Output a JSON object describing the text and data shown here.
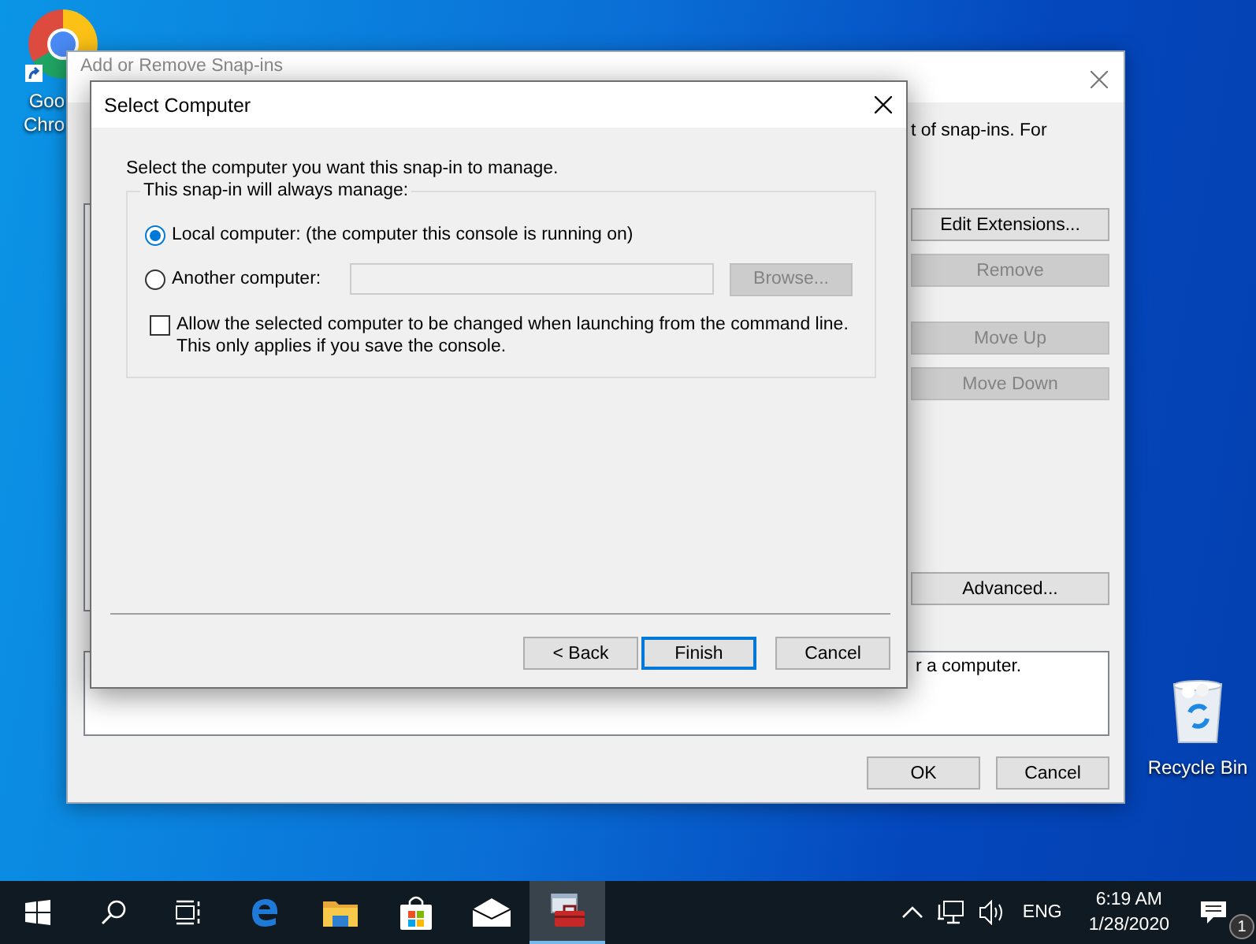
{
  "desktop_icons": [
    {
      "kind": "chrome",
      "label_lines": [
        "Goo",
        "Chro"
      ]
    },
    {
      "kind": "recycle-bin",
      "label_lines": [
        "Recycle Bin"
      ]
    }
  ],
  "back_window": {
    "title": "Add or Remove Snap-ins",
    "intro_right": "t of snap-ins. For",
    "description_text": "r a computer.",
    "side_buttons": [
      {
        "label": "Edit Extensions...",
        "disabled": false
      },
      {
        "label": "Remove",
        "disabled": true
      },
      {
        "label": "Move Up",
        "disabled": true
      },
      {
        "label": "Move Down",
        "disabled": true
      },
      {
        "label": "Advanced...",
        "disabled": false
      }
    ],
    "buttons": [
      {
        "label": "OK"
      },
      {
        "label": "Cancel"
      }
    ]
  },
  "dialog": {
    "title": "Select Computer",
    "intro": "Select the computer you want this snap-in to manage.",
    "group_label": "This snap-in will always manage:",
    "options": [
      {
        "label": "Local computer:  (the computer this console is running on)",
        "selected": true,
        "kind": "plain"
      },
      {
        "label": "Another computer:",
        "selected": false,
        "kind": "with-field",
        "field": {
          "disabled": true
        },
        "browse": {
          "label": "Browse...",
          "disabled": true
        }
      }
    ],
    "allow_change": {
      "label": "Allow the selected computer to be changed when launching from the command line.  This only applies if you save the console.",
      "checked": false
    },
    "buttons": [
      {
        "label": "< Back",
        "default": false
      },
      {
        "label": "Finish",
        "default": true
      },
      {
        "label": "Cancel",
        "default": false
      }
    ]
  },
  "taskbar": {
    "apps": [
      {
        "kind": "start",
        "selected": false
      },
      {
        "kind": "search",
        "selected": false
      },
      {
        "kind": "task-view",
        "selected": false
      },
      {
        "kind": "edge",
        "selected": false
      },
      {
        "kind": "explorer",
        "selected": false
      },
      {
        "kind": "store",
        "selected": false
      },
      {
        "kind": "mail",
        "selected": false
      },
      {
        "kind": "mmc",
        "selected": true
      }
    ],
    "language": "ENG",
    "time": "6:19 AM",
    "date": "1/28/2020",
    "notification_count": "1"
  }
}
